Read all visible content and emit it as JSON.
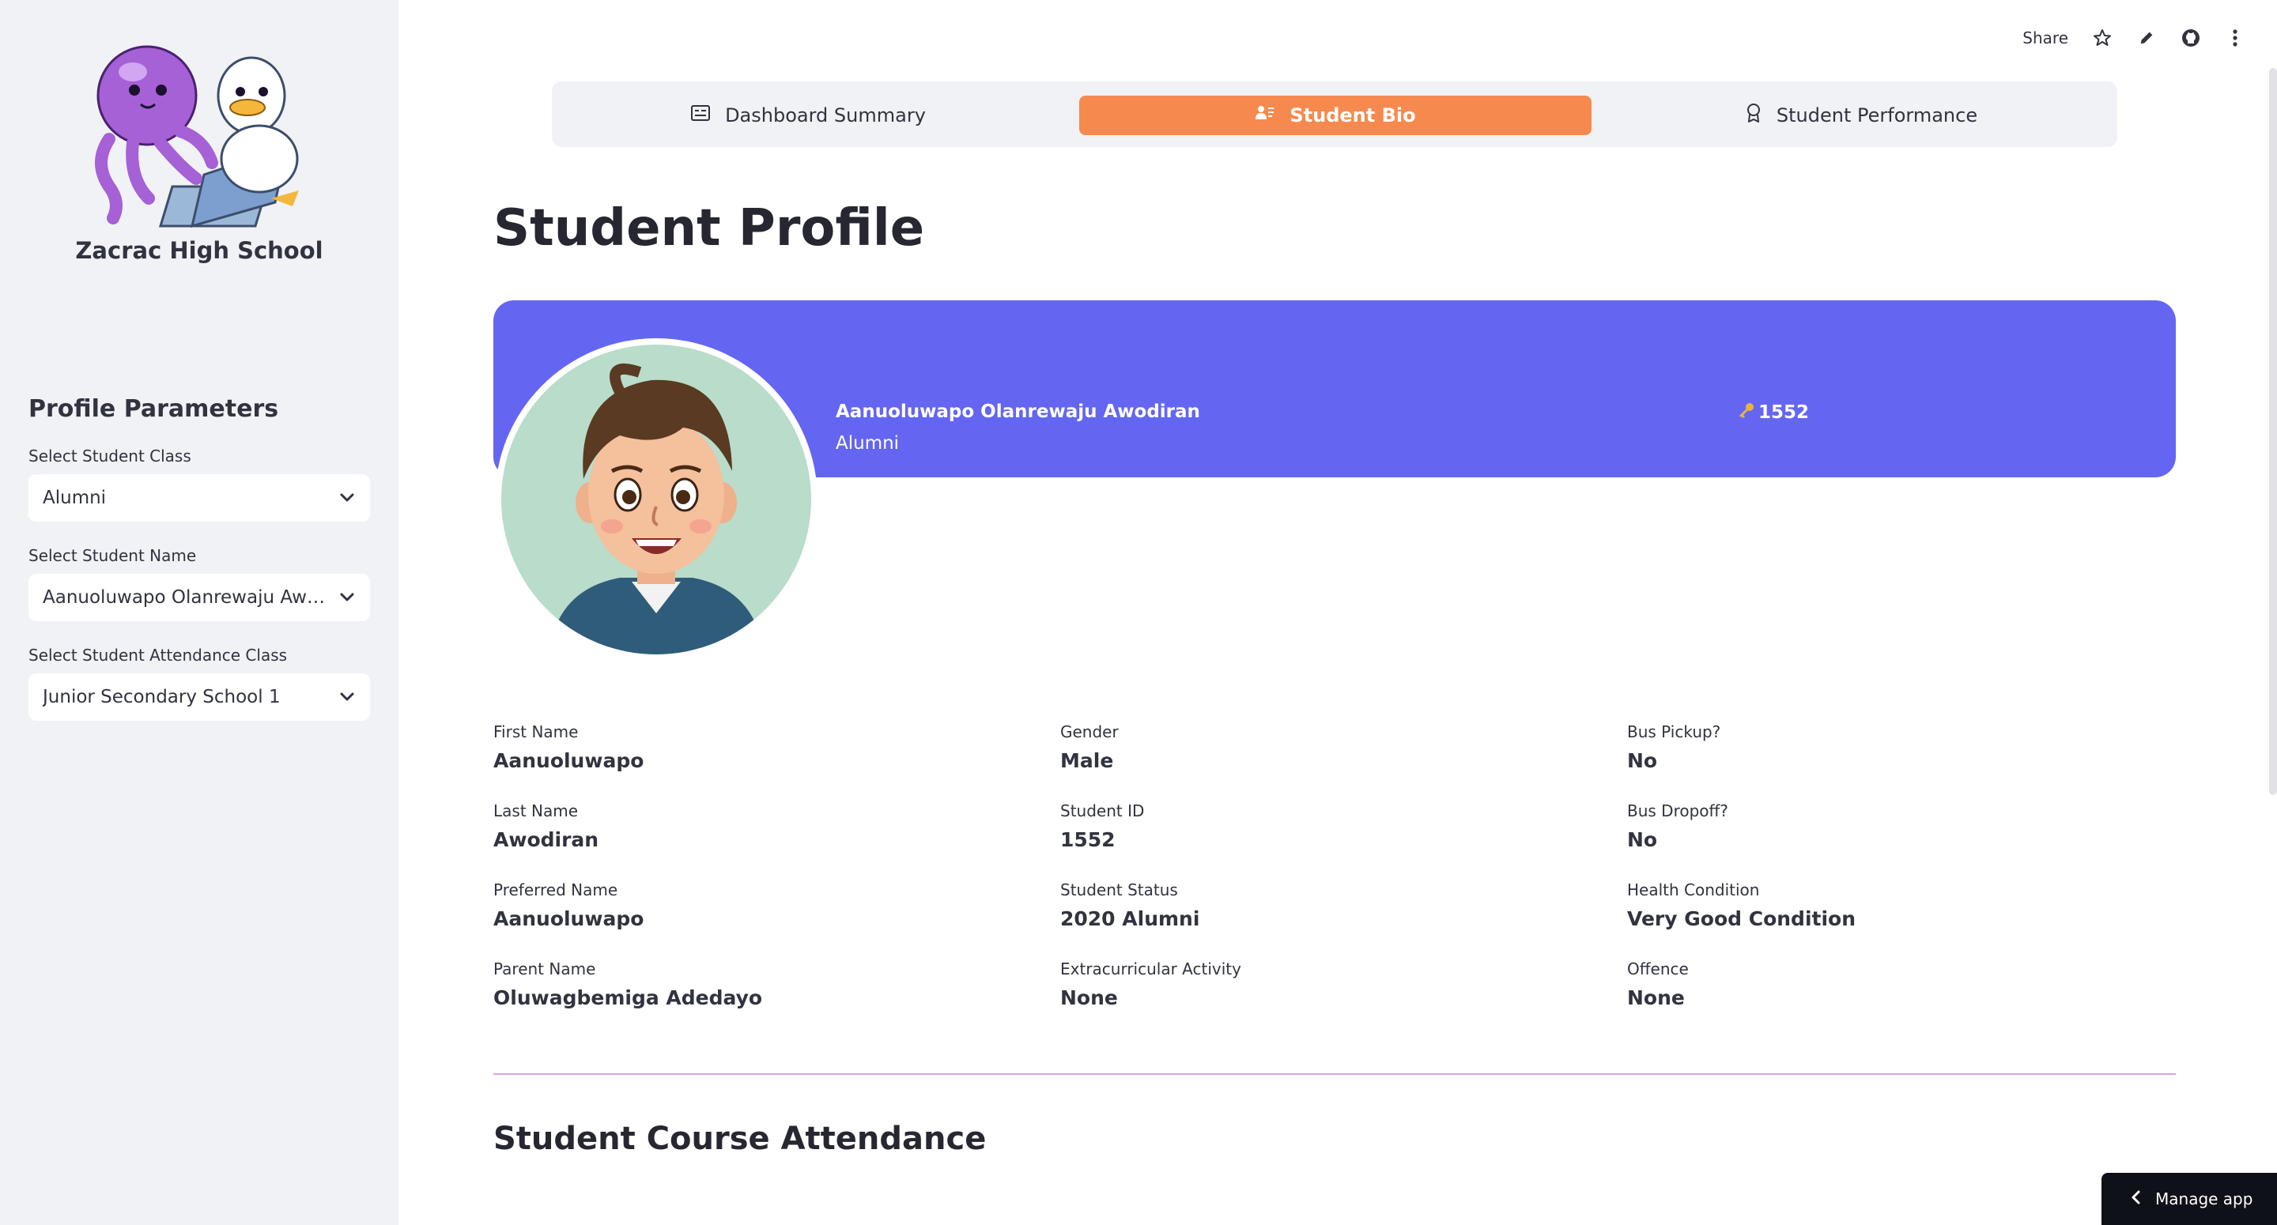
{
  "sidebar": {
    "school_name": "Zacrac High School",
    "heading": "Profile Parameters",
    "filters": [
      {
        "label": "Select Student Class",
        "value": "Alumni"
      },
      {
        "label": "Select Student Name",
        "value": "Aanuoluwapo Olanrewaju Awodiran"
      },
      {
        "label": "Select Student Attendance Class",
        "value": "Junior Secondary School 1"
      }
    ]
  },
  "toolbar": {
    "share_label": "Share",
    "icons": [
      "star-icon",
      "pencil-icon",
      "github-icon",
      "more-vertical-icon"
    ]
  },
  "tabs": [
    {
      "label": "Dashboard Summary",
      "icon": "dashboard-icon",
      "active": false
    },
    {
      "label": "Student Bio",
      "icon": "user-bio-icon",
      "active": true
    },
    {
      "label": "Student Performance",
      "icon": "award-icon",
      "active": false
    }
  ],
  "page": {
    "title": "Student Profile",
    "banner": {
      "name": "Aanuoluwapo Olanrewaju Awodiran",
      "status": "Alumni",
      "id": "1552",
      "id_icon": "key-icon",
      "color": "#6466f1"
    },
    "fields": [
      {
        "label": "First Name",
        "value": "Aanuoluwapo"
      },
      {
        "label": "Last Name",
        "value": "Awodiran"
      },
      {
        "label": "Preferred Name",
        "value": "Aanuoluwapo"
      },
      {
        "label": "Parent Name",
        "value": "Oluwagbemiga Adedayo"
      },
      {
        "label": "Gender",
        "value": "Male"
      },
      {
        "label": "Student ID",
        "value": "1552"
      },
      {
        "label": "Student Status",
        "value": "2020 Alumni"
      },
      {
        "label": "Extracurricular Activity",
        "value": "None"
      },
      {
        "label": "Bus Pickup?",
        "value": "No"
      },
      {
        "label": "Bus Dropoff?",
        "value": "No"
      },
      {
        "label": "Health Condition",
        "value": "Very Good Condition"
      },
      {
        "label": "Offence",
        "value": "None"
      }
    ],
    "section_title": "Student Course Attendance"
  },
  "manage_app_label": "Manage app",
  "colors": {
    "accent": "#f68a4e",
    "banner": "#6466f1",
    "sidebar_bg": "#f0f2f6"
  }
}
